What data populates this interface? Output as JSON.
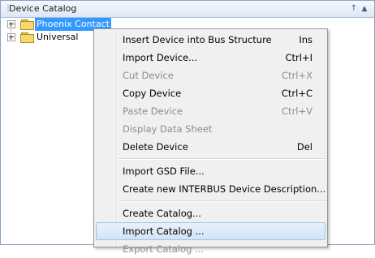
{
  "window": {
    "title": "Device Catalog",
    "pin_glyph": "↑",
    "dropdown_glyph": "▲"
  },
  "tree": {
    "items": [
      {
        "label": "Phoenix Contact",
        "icon": "folder-icon",
        "selected": true
      },
      {
        "label": "Universal",
        "icon": "folder-icon",
        "selected": false
      }
    ]
  },
  "context_menu": {
    "items": [
      {
        "label": "Insert Device into Bus Structure",
        "shortcut": "Ins",
        "enabled": true
      },
      {
        "label": "Import Device...",
        "shortcut": "Ctrl+I",
        "enabled": true
      },
      {
        "label": "Cut Device",
        "shortcut": "Ctrl+X",
        "enabled": false
      },
      {
        "label": "Copy Device",
        "shortcut": "Ctrl+C",
        "enabled": true
      },
      {
        "label": "Paste Device",
        "shortcut": "Ctrl+V",
        "enabled": false
      },
      {
        "label": "Display Data Sheet",
        "shortcut": "",
        "enabled": false
      },
      {
        "label": "Delete Device",
        "shortcut": "Del",
        "enabled": true
      },
      {
        "label": "Import GSD File...",
        "shortcut": "",
        "enabled": true
      },
      {
        "label": "Create new INTERBUS Device Description...",
        "shortcut": "",
        "enabled": true
      },
      {
        "label": "Create Catalog...",
        "shortcut": "",
        "enabled": true
      },
      {
        "label": "Import Catalog ...",
        "shortcut": "",
        "enabled": true,
        "highlighted": true
      },
      {
        "label": "Export Catalog ...",
        "shortcut": "",
        "enabled": false
      }
    ]
  },
  "colors": {
    "selection": "#3399ff",
    "menu_background": "#f0f0f0",
    "disabled_text": "#8d8d8d",
    "title_bar": "#dde7f4"
  }
}
